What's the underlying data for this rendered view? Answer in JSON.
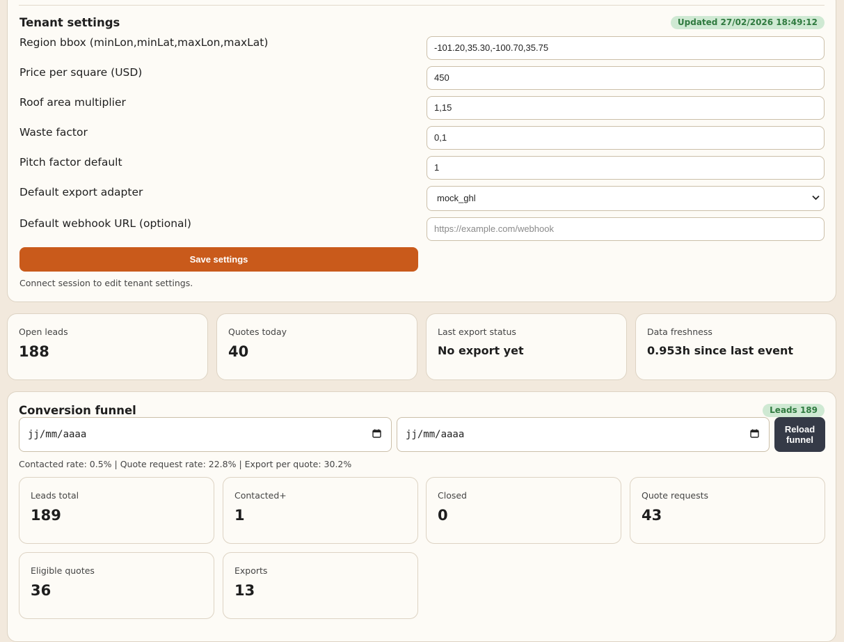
{
  "settings": {
    "title": "Tenant settings",
    "updated_badge": "Updated 27/02/2026 18:49:12",
    "fields": [
      {
        "label": "Region bbox (minLon,minLat,maxLon,maxLat)",
        "value": "-101.20,35.30,-100.70,35.75"
      },
      {
        "label": "Price per square (USD)",
        "value": "450"
      },
      {
        "label": "Roof area multiplier",
        "value": "1,15"
      },
      {
        "label": "Waste factor",
        "value": "0,1"
      },
      {
        "label": "Pitch factor default",
        "value": "1"
      },
      {
        "label": "Default export adapter",
        "value": "mock_ghl"
      },
      {
        "label": "Default webhook URL (optional)",
        "placeholder": "https://example.com/webhook"
      }
    ],
    "save_label": "Save settings",
    "note": "Connect session to edit tenant settings."
  },
  "stats": [
    {
      "label": "Open leads",
      "value": "188"
    },
    {
      "label": "Quotes today",
      "value": "40"
    },
    {
      "label": "Last export status",
      "value": "No export yet"
    },
    {
      "label": "Data freshness",
      "value": "0.953h since last event"
    }
  ],
  "funnel": {
    "title": "Conversion funnel",
    "leads_badge": "Leads 189",
    "date_from_placeholder": "jj/mm/aaaa",
    "date_to_placeholder": "jj/mm/aaaa",
    "reload_label_1": "Reload",
    "reload_label_2": "funnel",
    "rates": "Contacted rate: 0.5% | Quote request rate: 22.8% | Export per quote: 30.2%",
    "metrics": [
      {
        "label": "Leads total",
        "value": "189"
      },
      {
        "label": "Contacted+",
        "value": "1"
      },
      {
        "label": "Closed",
        "value": "0"
      },
      {
        "label": "Quote requests",
        "value": "43"
      },
      {
        "label": "Eligible quotes",
        "value": "36"
      },
      {
        "label": "Exports",
        "value": "13"
      }
    ]
  }
}
